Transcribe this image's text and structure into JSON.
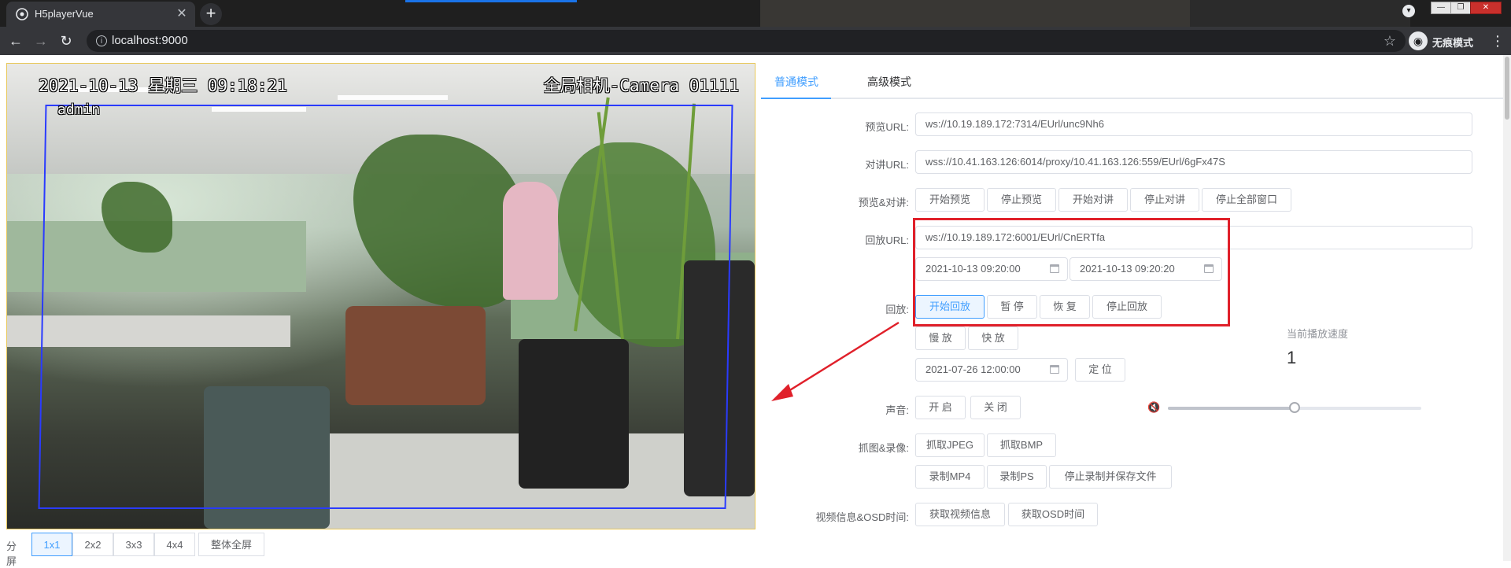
{
  "browser": {
    "tab_title": "H5playerVue",
    "tab_close": "✕",
    "new_tab": "+",
    "url": "localhost:9000",
    "incognito_label": "无痕模式",
    "window_buttons": [
      "—",
      "❐",
      "✕"
    ]
  },
  "video": {
    "osd_datetime": "2021-10-13 星期三 09:18:21",
    "osd_user": "admin",
    "osd_camera": "全局相机-Camera 01111"
  },
  "split": {
    "label": "分屏",
    "buttons": [
      "1x1",
      "2x2",
      "3x3",
      "4x4",
      "整体全屏"
    ],
    "active": "1x1"
  },
  "tabs": {
    "normal": "普通模式",
    "advanced": "高级模式"
  },
  "form": {
    "preview_url_label": "预览URL:",
    "preview_url": "ws://10.19.189.172:7314/EUrl/unc9Nh6",
    "talk_url_label": "对讲URL:",
    "talk_url": "wss://10.41.163.126:6014/proxy/10.41.163.126:559/EUrl/6gFx47S",
    "preview_talk_label": "预览&对讲:",
    "preview_talk_buttons": [
      "开始预览",
      "停止预览",
      "开始对讲",
      "停止对讲",
      "停止全部窗口"
    ],
    "playback_url_label": "回放URL:",
    "playback_url": "ws://10.19.189.172:6001/EUrl/CnERTfa",
    "start_time": "2021-10-13 09:20:00",
    "end_time": "2021-10-13 09:20:20",
    "playback_label": "回放:",
    "playback_buttons": [
      "开始回放",
      "暂 停",
      "恢 复",
      "停止回放"
    ],
    "speed_buttons": [
      "慢 放",
      "快 放"
    ],
    "seek_time": "2021-07-26 12:00:00",
    "seek_button": "定 位",
    "speed_label": "当前播放速度",
    "speed_value": "1",
    "sound_label": "声音:",
    "sound_buttons": [
      "开 启",
      "关 闭"
    ],
    "volume_level": 0.5,
    "capture_label": "抓图&录像:",
    "capture_buttons": [
      "抓取JPEG",
      "抓取BMP"
    ],
    "record_buttons": [
      "录制MP4",
      "录制PS",
      "停止录制并保存文件"
    ],
    "osd_label": "视频信息&OSD时间:",
    "osd_buttons": [
      "获取视频信息",
      "获取OSD时间"
    ]
  },
  "colors": {
    "accent": "#409eff",
    "annotation_red": "#e0202a",
    "border": "#dcdfe6"
  },
  "icons": [
    "browser-favicon",
    "back-arrow-icon",
    "forward-arrow-icon",
    "reload-icon",
    "info-icon",
    "star-icon",
    "incognito-icon",
    "kebab-menu-icon",
    "calendar-icon",
    "mute-icon"
  ]
}
